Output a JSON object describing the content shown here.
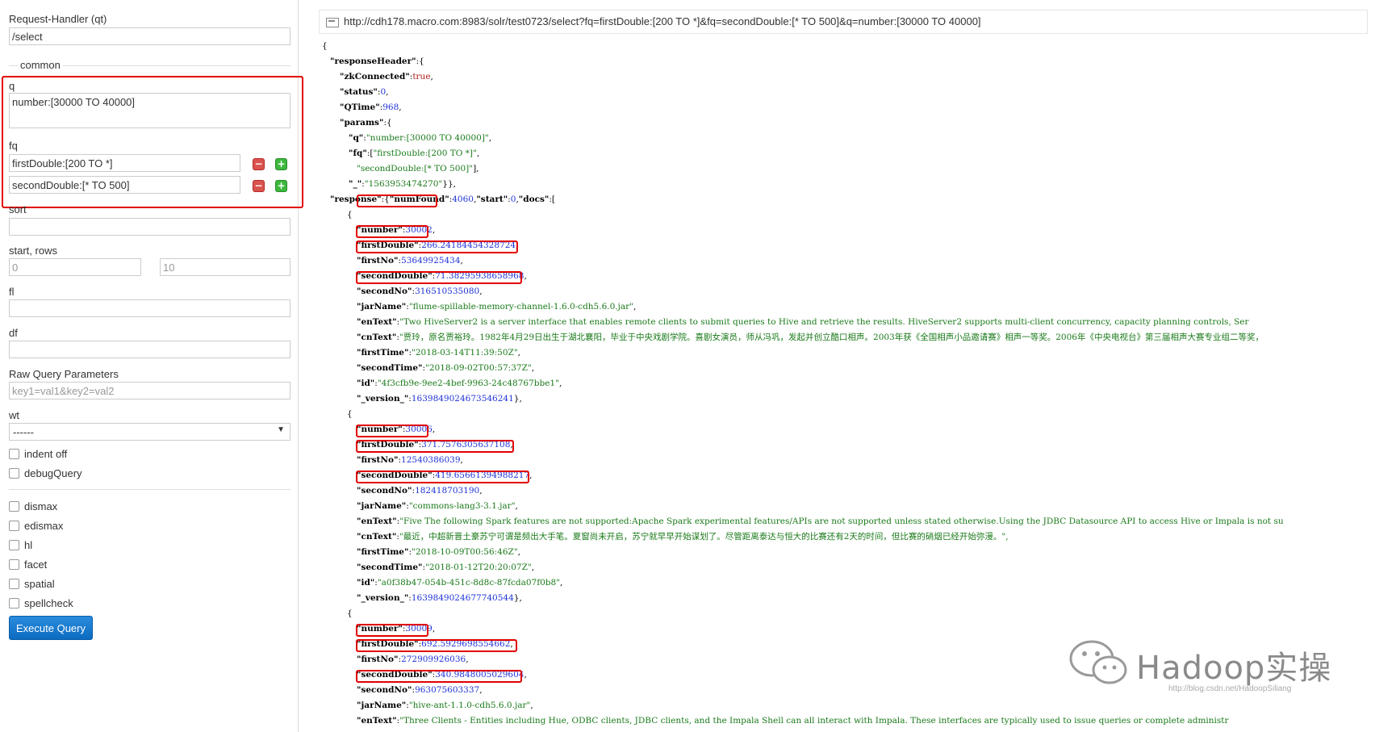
{
  "form": {
    "request_handler_label": "Request-Handler (qt)",
    "request_handler_value": "/select",
    "common_label": "common",
    "q_label": "q",
    "q_value": "number:[30000 TO 40000]",
    "fq_label": "fq",
    "fq1_value": "firstDouble:[200 TO *]",
    "fq2_value": "secondDouble:[* TO 500]",
    "sort_label": "sort",
    "start_rows_label": "start, rows",
    "start_value": "0",
    "rows_value": "10",
    "fl_label": "fl",
    "df_label": "df",
    "raw_label": "Raw Query Parameters",
    "raw_placeholder": "key1=val1&key2=val2",
    "wt_label": "wt",
    "wt_value": "------",
    "checkboxes": [
      "indent off",
      "debugQuery"
    ],
    "checkboxes2": [
      "dismax",
      "edismax",
      "hl",
      "facet",
      "spatial",
      "spellcheck"
    ],
    "execute_label": "Execute Query"
  },
  "response": {
    "url": "http://cdh178.macro.com:8983/solr/test0723/select?fq=firstDouble:[200 TO *]&fq=secondDouble:[* TO 500]&q=number:[30000 TO 40000]",
    "header": {
      "zkConnected": "true",
      "status": "0",
      "QTime": "968",
      "q": "\"number:[30000 TO 40000]\"",
      "fq1": "\"firstDouble:[200 TO *]\"",
      "fq2": "\"secondDouble:[* TO 500]\"",
      "underscore": "\"1563953474270\""
    },
    "numFound": "4060",
    "start": "0",
    "docs": [
      {
        "number": "30002",
        "firstDouble": "266.24184454328724",
        "firstNo": "53649925434",
        "secondDouble": "71.38295938658968",
        "secondNo": "316510535080",
        "jarName": "\"flume-spillable-memory-channel-1.6.0-cdh5.6.0.jar\"",
        "enText": "\"Two HiveServer2 is a server interface that enables remote clients to submit queries to Hive and retrieve the results. HiveServer2 supports multi-client concurrency,  capacity planning controls,  Ser",
        "cnText": "\"贾玲，原名贾裕玲。1982年4月29日出生于湖北襄阳，毕业于中央戏剧学院。喜剧女演员，师从冯巩，发起并创立酷口相声。2003年获《全国相声小品邀请赛》相声一等奖。2006年《中央电视台》第三届相声大赛专业组二等奖，",
        "firstTime": "\"2018-03-14T11:39:50Z\"",
        "secondTime": "\"2018-09-02T00:57:37Z\"",
        "id": "\"4f3cfb9e-9ee2-4bef-9963-24c48767bbe1\"",
        "version": "1639849024673546241"
      },
      {
        "number": "30006",
        "firstDouble": "371.7576305637108",
        "firstNo": "12540386039",
        "secondDouble": "419.65661394988217",
        "secondNo": "182418703190",
        "jarName": "\"commons-lang3-3.1.jar\"",
        "enText": "\"Five The following Spark features are not supported:Apache Spark experimental features/APIs are not supported unless stated otherwise.Using the JDBC Datasource API to access Hive or Impala is not su",
        "cnText": "\"最近，中超新晋土豪苏宁可谓是频出大手笔。夏窗尚未开启，苏宁就早早开始谋划了。尽管距离泰达与恒大的比赛还有2天的时间，但比赛的硝烟已经开始弥漫。\",",
        "firstTime": "\"2018-10-09T00:56:46Z\"",
        "secondTime": "\"2018-01-12T20:20:07Z\"",
        "id": "\"a0f38b47-054b-451c-8d8c-87fcda07f0b8\"",
        "version": "1639849024677740544"
      },
      {
        "number": "30009",
        "firstDouble": "692.5929698554662",
        "firstNo": "272909926036",
        "secondDouble": "340.9848005029604",
        "secondNo": "963075603337",
        "jarName": "\"hive-ant-1.1.0-cdh5.6.0.jar\"",
        "enText": "\"Three Clients - Entities including Hue,  ODBC clients,  JDBC clients,  and the Impala Shell can all interact with Impala. These interfaces are typically used to issue queries or complete administr"
      }
    ]
  },
  "watermark": {
    "text": "Hadoop实操",
    "url": "http://blog.csdn.net/HadoopSiliang"
  }
}
